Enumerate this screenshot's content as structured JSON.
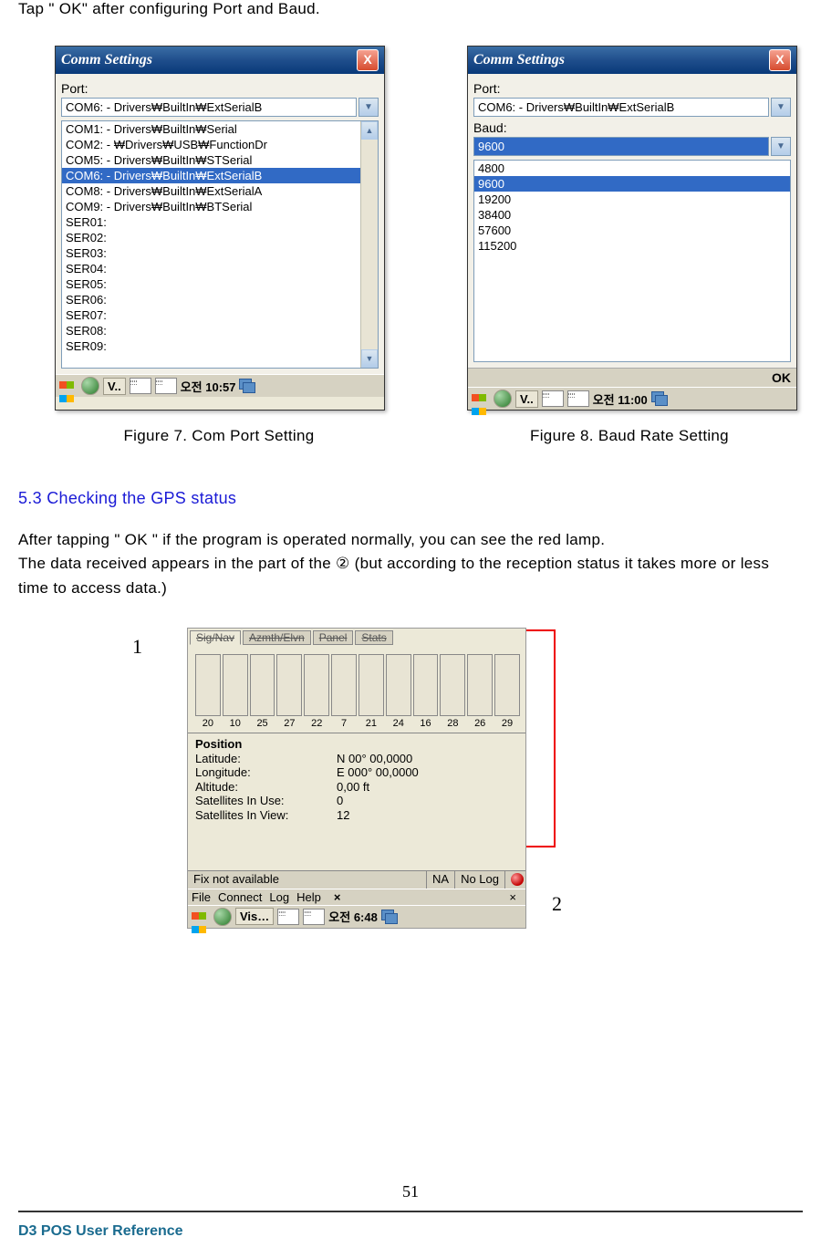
{
  "intro": "Tap \" OK\"  after configuring Port and Baud.",
  "fig7": {
    "title": "Comm Settings",
    "port_label": "Port:",
    "port_selected": "COM6: - Drivers₩BuiltIn₩ExtSerialB",
    "port_list": [
      "COM1: - Drivers₩BuiltIn₩Serial",
      "COM2: - ₩Drivers₩USB₩FunctionDr",
      "COM5: - Drivers₩BuiltIn₩STSerial",
      "COM6: - Drivers₩BuiltIn₩ExtSerialB",
      "COM8: - Drivers₩BuiltIn₩ExtSerialA",
      "COM9: - Drivers₩BuiltIn₩BTSerial",
      "SER01:",
      "SER02:",
      "SER03:",
      "SER04:",
      "SER05:",
      "SER06:",
      "SER07:",
      "SER08:",
      "SER09:"
    ],
    "selected_index": 3,
    "taskbar_app": "V..",
    "taskbar_time": "오전 10:57",
    "caption": "Figure 7. Com Port Setting"
  },
  "fig8": {
    "title": "Comm Settings",
    "port_label": "Port:",
    "port_selected": "COM6: - Drivers₩BuiltIn₩ExtSerialB",
    "baud_label": "Baud:",
    "baud_selected": "9600",
    "baud_list": [
      "4800",
      "9600",
      "19200",
      "38400",
      "57600",
      "115200"
    ],
    "selected_index": 1,
    "ok_label": "OK",
    "taskbar_app": "V..",
    "taskbar_time": "오전 11:00",
    "caption": "Figure 8. Baud Rate Setting"
  },
  "section_heading": "5.3 Checking the GPS status",
  "para1": "After tapping \"  OK \"  if the program is operated normally, you can see the red lamp.",
  "para2": "The data received appears in the part of the  ②  (but according to the reception status it takes more or less time to access data.)",
  "annot1": "1",
  "annot_circ": "①",
  "annot2": "2",
  "gps": {
    "tabs": [
      "Sig/Nav",
      "Azmth/Elvn",
      "Panel",
      "Stats"
    ],
    "sat_nums": [
      "20",
      "10",
      "25",
      "27",
      "22",
      "7",
      "21",
      "24",
      "16",
      "28",
      "26",
      "29"
    ],
    "position_title": "Position",
    "rows": [
      {
        "k": "Latitude:",
        "v": "N 00° 00,0000"
      },
      {
        "k": "Longitude:",
        "v": "E 000° 00,0000"
      },
      {
        "k": "Altitude:",
        "v": "0,00    ft"
      },
      {
        "k": "Satellites In Use:",
        "v": "0"
      },
      {
        "k": "Satellites In View:",
        "v": "12"
      }
    ],
    "status_fix": "Fix not available",
    "status_na": "NA",
    "status_log": "No Log",
    "menu": [
      "File",
      "Connect",
      "Log",
      "Help"
    ],
    "menu_x": "×",
    "taskbar_app": "Vis…",
    "taskbar_time": "오전 6:48"
  },
  "page_number": "51",
  "footer": "D3 POS User Reference"
}
